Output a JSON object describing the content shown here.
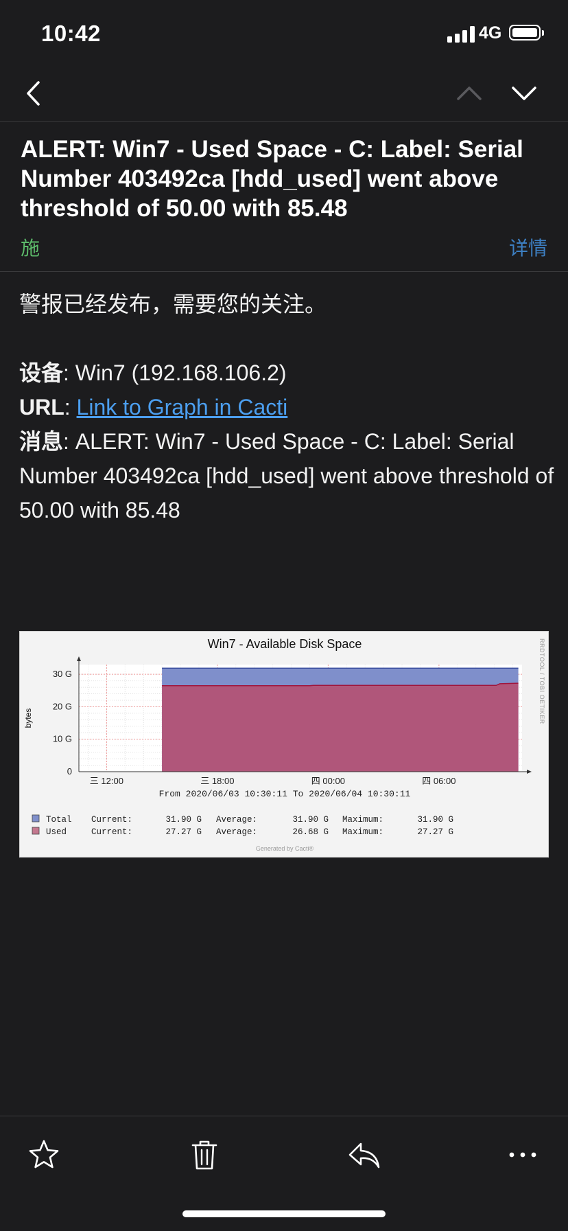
{
  "status_bar": {
    "time": "10:42",
    "network": "4G"
  },
  "nav": {
    "back_icon": "chevron-left-icon",
    "prev_icon": "chevron-up-icon",
    "next_icon": "chevron-down-icon"
  },
  "email": {
    "subject": "ALERT: Win7 - Used Space - C: Label:  Serial Number 403492ca [hdd_used] went above threshold of 50.00 with 85.48",
    "sender": "施",
    "details_label": "详情",
    "intro": "警报已经发布，需要您的关注。",
    "device_key": "设备",
    "device_value": ": Win7 (192.168.106.2)",
    "url_key": "URL",
    "url_sep": ": ",
    "url_link_text": "Link to Graph in Cacti",
    "message_key": "消息",
    "message_value": ": ALERT: Win7 - Used Space - C: Label: Serial Number 403492ca [hdd_used] went above threshold of 50.00 with 85.48"
  },
  "chart_data": {
    "type": "area",
    "title": "Win7 - Available Disk Space",
    "ylabel": "bytes",
    "ylim": [
      0,
      33
    ],
    "y_ticks": [
      "0",
      "10 G",
      "20 G",
      "30 G"
    ],
    "x_tick_labels": [
      "三 12:00",
      "三 18:00",
      "四 00:00",
      "四 06:00"
    ],
    "x_range_hours": [
      10.5,
      34.5
    ],
    "x_ticks_hours": [
      12,
      18,
      24,
      30
    ],
    "range_text": "From 2020/06/03 10:30:11 To 2020/06/04 10:30:11",
    "side_text": "RRDTOOL / TOBI OETIKER",
    "footer": "Generated by Cacti®",
    "series": [
      {
        "name": "Total",
        "color": "#7f8fcb",
        "line_color": "#3b4fa0",
        "points": [
          [
            15.0,
            31.9
          ],
          [
            34.3,
            31.9
          ]
        ]
      },
      {
        "name": "Used",
        "color": "#b0567a",
        "line_color": "#a0153c",
        "points": [
          [
            15.0,
            26.5
          ],
          [
            23.0,
            26.5
          ],
          [
            23.2,
            26.6
          ],
          [
            33.1,
            26.6
          ],
          [
            33.3,
            27.1
          ],
          [
            34.3,
            27.27
          ]
        ]
      }
    ],
    "legend": [
      {
        "name": "Total",
        "color": "#7f8fcb",
        "current": "31.90 G",
        "average": "31.90 G",
        "maximum": "31.90 G"
      },
      {
        "name": "Used",
        "color": "#c4788f",
        "current": "27.27 G",
        "average": "26.68 G",
        "maximum": "27.27 G"
      }
    ],
    "legend_labels": {
      "current": "Current:",
      "average": "Average:",
      "maximum": "Maximum:"
    }
  },
  "toolbar": {
    "star_icon": "star-icon",
    "trash_icon": "trash-icon",
    "reply_icon": "reply-icon",
    "more_icon": "more-icon"
  }
}
